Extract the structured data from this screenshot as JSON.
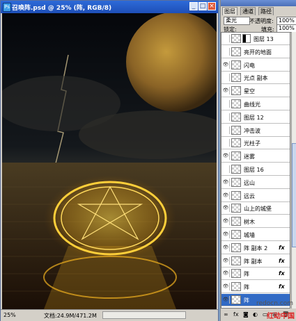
{
  "document": {
    "title": "召唤阵.psd @ 25% (阵, RGB/8)",
    "title_icon": "Ps",
    "window_buttons": [
      "_",
      "□",
      "×"
    ],
    "status": {
      "zoom": "25%",
      "doc_size": "文档:24.9M/471.2M"
    }
  },
  "layers_panel": {
    "tabs": [
      "图层",
      "通道",
      "路径"
    ],
    "blend_mode": "柔光",
    "opacity_label": "不透明度:",
    "opacity_value": "100%",
    "lock_label": "锁定:",
    "fill_label": "填充:",
    "fill_value": "100%",
    "layers": [
      {
        "name": "图层 13",
        "visible": false,
        "masked": true,
        "fx": false,
        "selected": false
      },
      {
        "name": "亮开的地面",
        "visible": false,
        "masked": false,
        "fx": false,
        "selected": false
      },
      {
        "name": "闪电",
        "visible": true,
        "masked": false,
        "fx": false,
        "selected": false
      },
      {
        "name": "光点 副本",
        "visible": false,
        "masked": false,
        "fx": false,
        "selected": false
      },
      {
        "name": "星空",
        "visible": true,
        "masked": false,
        "fx": false,
        "selected": false
      },
      {
        "name": "曲线光",
        "visible": false,
        "masked": false,
        "fx": false,
        "selected": false
      },
      {
        "name": "图层 12",
        "visible": false,
        "masked": false,
        "fx": false,
        "selected": false
      },
      {
        "name": "冲击波",
        "visible": false,
        "masked": false,
        "fx": false,
        "selected": false
      },
      {
        "name": "光柱子",
        "visible": false,
        "masked": false,
        "fx": false,
        "selected": false
      },
      {
        "name": "迷雾",
        "visible": true,
        "masked": false,
        "fx": false,
        "selected": false
      },
      {
        "name": "图层 16",
        "visible": false,
        "masked": false,
        "fx": false,
        "selected": false
      },
      {
        "name": "远山",
        "visible": true,
        "masked": false,
        "fx": false,
        "selected": false
      },
      {
        "name": "远云",
        "visible": true,
        "masked": false,
        "fx": false,
        "selected": false
      },
      {
        "name": "山上的城堡",
        "visible": true,
        "masked": false,
        "fx": false,
        "selected": false
      },
      {
        "name": "树木",
        "visible": true,
        "masked": false,
        "fx": false,
        "selected": false
      },
      {
        "name": "城墙",
        "visible": true,
        "masked": false,
        "fx": false,
        "selected": false
      },
      {
        "name": "阵 副本 2",
        "visible": true,
        "masked": false,
        "fx": true,
        "selected": false
      },
      {
        "name": "阵 副本",
        "visible": true,
        "masked": false,
        "fx": true,
        "selected": false
      },
      {
        "name": "阵",
        "visible": true,
        "masked": false,
        "fx": true,
        "selected": false
      },
      {
        "name": "阵",
        "visible": true,
        "masked": false,
        "fx": true,
        "selected": false
      },
      {
        "name": "阵",
        "visible": true,
        "masked": false,
        "fx": false,
        "selected": true
      }
    ],
    "bottom_icons": [
      "link-icon",
      "fx-icon",
      "mask-icon",
      "adjustment-icon",
      "folder-icon",
      "new-layer-icon",
      "trash-icon"
    ]
  },
  "watermark": {
    "line1": "redocn.com",
    "line2": "红动中国"
  }
}
